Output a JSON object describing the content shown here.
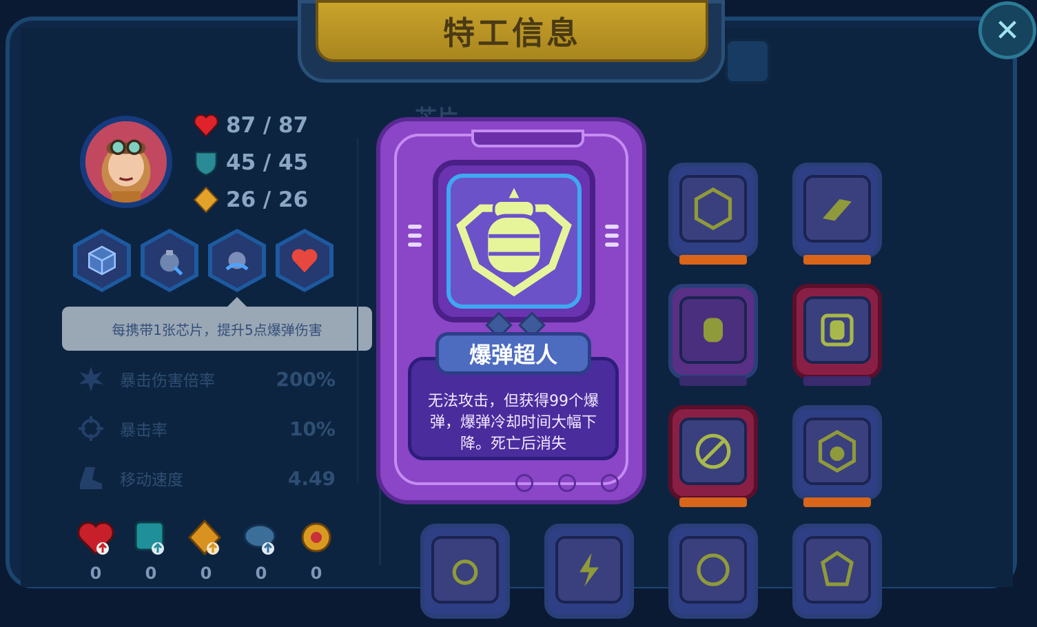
{
  "title": "特工信息",
  "close_icon": "close-icon",
  "stats": {
    "hp": "87 / 87",
    "shield": "45 / 45",
    "energy": "26 / 26"
  },
  "tooltip": "每携带1张芯片，提升5点爆弹伤害",
  "attributes": [
    {
      "label": "暴击伤害倍率",
      "value": "200%"
    },
    {
      "label": "暴击率",
      "value": "10%"
    },
    {
      "label": "移动速度",
      "value": "4.49"
    }
  ],
  "bottom_items": [
    {
      "icon": "heart-upgrade-icon",
      "count": "0"
    },
    {
      "icon": "shield-upgrade-icon",
      "count": "0"
    },
    {
      "icon": "energy-upgrade-icon",
      "count": "0"
    },
    {
      "icon": "weapon-upgrade-icon",
      "count": "0"
    },
    {
      "icon": "gear-upgrade-icon",
      "count": "0"
    }
  ],
  "tab_label": "芯片",
  "popup": {
    "name": "爆弹超人",
    "description": "无法攻击，但获得99个爆弹，爆弹冷却时间大幅下降。死亡后消失"
  },
  "colors": {
    "popup_purple": "#8a46c6",
    "gold": "#c9a32b",
    "background": "#0f2847"
  }
}
